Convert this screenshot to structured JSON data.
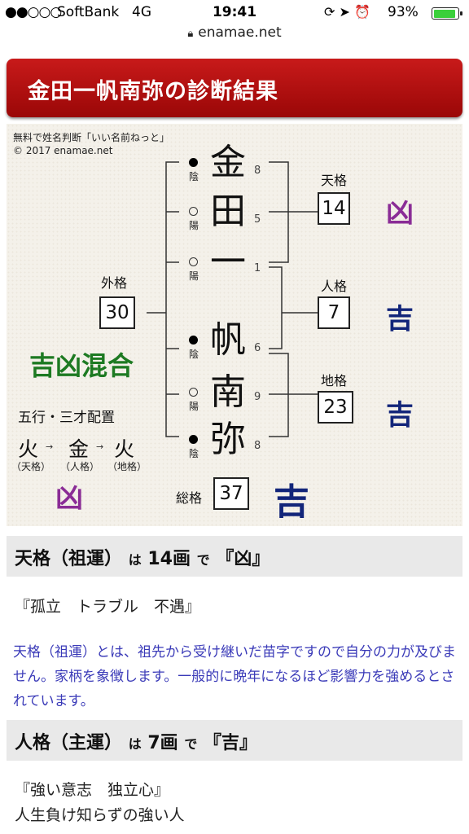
{
  "status_bar": {
    "signal": "●●○○○",
    "carrier": "SoftBank",
    "network": "4G",
    "time": "19:41",
    "icons": "⟳ ➤ ⏰",
    "battery_pct": "93%",
    "battery_level": 0.93,
    "battery_color": "#3bd03b"
  },
  "url_bar": {
    "lock_icon": "lock-icon",
    "domain": "enamae.net"
  },
  "header": {
    "title": "金田一帆南弥の診断結果",
    "color": "#b01010"
  },
  "diagram": {
    "credit_line1": "無料で姓名判断「いい名前ねっと」",
    "credit_line2": "© 2017 enamae.net",
    "characters": [
      {
        "char": "金",
        "strokes": "8",
        "yinyang": "陰"
      },
      {
        "char": "田",
        "strokes": "5",
        "yinyang": "陽"
      },
      {
        "char": "一",
        "strokes": "1",
        "yinyang": "陽"
      },
      {
        "char": "帆",
        "strokes": "6",
        "yinyang": "陰"
      },
      {
        "char": "南",
        "strokes": "9",
        "yinyang": "陽"
      },
      {
        "char": "弥",
        "strokes": "8",
        "yinyang": "陰"
      }
    ],
    "tenkaku": {
      "label": "天格",
      "value": "14",
      "verdict": "凶"
    },
    "jinkaku": {
      "label": "人格",
      "value": "7",
      "verdict": "吉"
    },
    "chikaku": {
      "label": "地格",
      "value": "23",
      "verdict": "吉"
    },
    "gaikaku": {
      "label": "外格",
      "value": "30"
    },
    "soukaku": {
      "label": "総格",
      "value": "37",
      "verdict": "吉"
    },
    "yinyang_result": "吉凶混合",
    "gogyou": {
      "title": "五行・三才配置",
      "elements": [
        "火",
        "金",
        "火"
      ],
      "arrow": "→",
      "labels": [
        "（天格）",
        "（人格）",
        "（地格）"
      ],
      "verdict": "凶"
    },
    "colors": {
      "kyou": "#8a2c96",
      "kichi": "#12257a",
      "mixed": "#1d7a22"
    }
  },
  "sections": [
    {
      "heading_main": "天格（祖運）",
      "heading_ha": "は",
      "heading_count": "14画",
      "heading_de": "で",
      "heading_result": "『凶』",
      "keywords": "『孤立　トラブル　不遇』",
      "description": "天格（祖運）とは、祖先から受け継いだ苗字ですので自分の力が及びません。家柄を象徴します。一般的に晩年になるほど影響力を強めるとされています。"
    },
    {
      "heading_main": "人格（主運）",
      "heading_ha": "は",
      "heading_count": "7画",
      "heading_de": "で",
      "heading_result": "『吉』",
      "keywords": "『強い意志　独立心』",
      "line2": "人生負け知らずの強い人"
    }
  ]
}
